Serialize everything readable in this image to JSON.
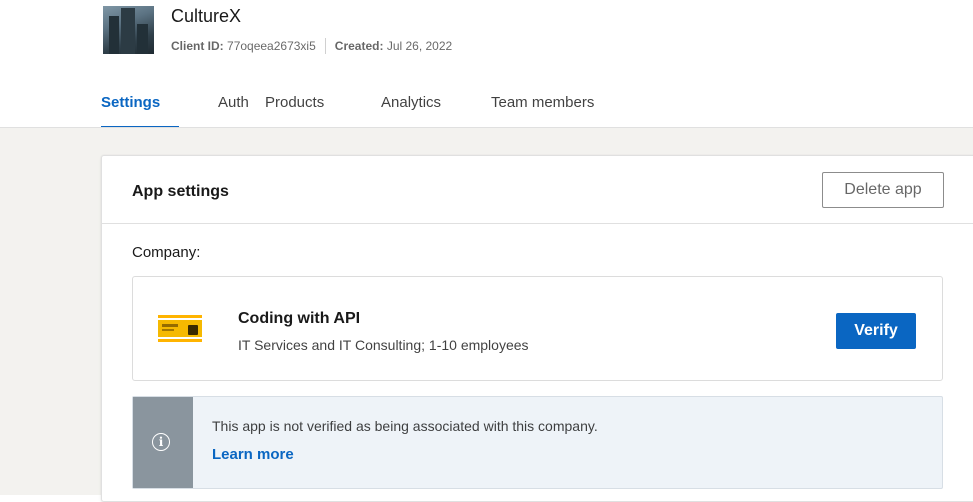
{
  "app": {
    "name": "CultureX",
    "client_id_label": "Client ID:",
    "client_id_value": "77oqeea2673xi5",
    "created_label": "Created:",
    "created_value": "Jul 26, 2022"
  },
  "tabs": [
    {
      "label": "Settings",
      "active": true
    },
    {
      "label": "Auth",
      "active": false
    },
    {
      "label": "Products",
      "active": false
    },
    {
      "label": "Analytics",
      "active": false
    },
    {
      "label": "Team members",
      "active": false
    }
  ],
  "settings_card": {
    "title": "App settings",
    "delete_button": "Delete app",
    "company_label": "Company:",
    "company": {
      "name": "Coding with API",
      "description": "IT Services and IT Consulting; 1-10 employees",
      "verify_button": "Verify"
    },
    "notice": {
      "text": "This app is not verified as being associated with this company.",
      "link": "Learn more",
      "icon": "info-icon"
    }
  },
  "colors": {
    "accent": "#0a66c2",
    "page_background": "#f3f2ef",
    "notice_background": "#eef3f8",
    "notice_side": "#8a959e"
  }
}
